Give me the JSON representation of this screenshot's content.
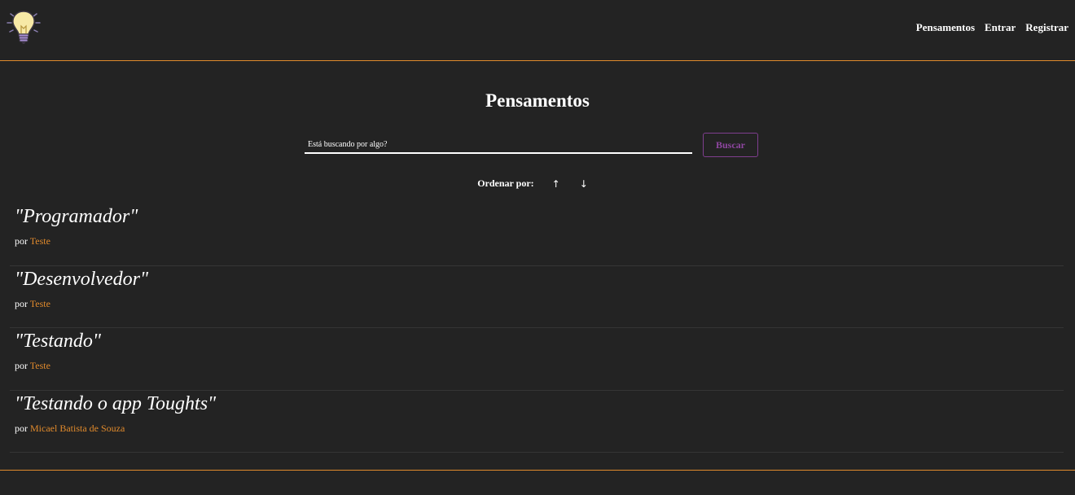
{
  "navbar": {
    "logo_icon": "lightbulb-icon",
    "links": [
      {
        "label": "Pensamentos"
      },
      {
        "label": "Entrar"
      },
      {
        "label": "Registrar"
      }
    ]
  },
  "main": {
    "title": "Pensamentos",
    "search": {
      "placeholder": "Está buscando por algo?",
      "value": "",
      "button_label": "Buscar"
    },
    "order": {
      "label": "Ordenar por:",
      "asc_icon": "↑",
      "desc_icon": "↓"
    },
    "thoughts": [
      {
        "title": "\"Programador\"",
        "by": "por",
        "author": "Teste"
      },
      {
        "title": "\"Desenvolvedor\"",
        "by": "por",
        "author": "Teste"
      },
      {
        "title": "\"Testando\"",
        "by": "por",
        "author": "Teste"
      },
      {
        "title": "\"Testando o app Toughts\"",
        "by": "por",
        "author": "Micael Batista de Souza"
      }
    ]
  },
  "colors": {
    "background": "#232323",
    "accent_orange": "#e08a2c",
    "button_purple": "#8e46a0",
    "text": "#ffffff"
  }
}
